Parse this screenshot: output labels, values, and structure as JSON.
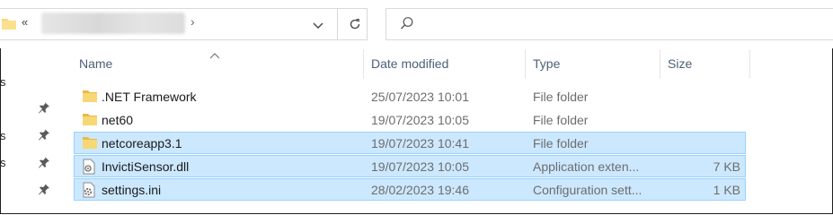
{
  "address": {
    "overflow_chevron": "«",
    "separator": "›",
    "dropdown_icon": "chevron-down-icon",
    "refresh_icon": "refresh-icon"
  },
  "search": {
    "placeholder": "",
    "icon": "search-icon"
  },
  "nav_fragments": [
    "s",
    "s",
    "s"
  ],
  "columns": {
    "name": "Name",
    "date": "Date modified",
    "type": "Type",
    "size": "Size"
  },
  "files": [
    {
      "name": ".NET Framework",
      "date": "25/07/2023 10:01",
      "type": "File folder",
      "size": "",
      "icon": "folder-icon",
      "selected": false
    },
    {
      "name": "net60",
      "date": "19/07/2023 10:05",
      "type": "File folder",
      "size": "",
      "icon": "folder-icon",
      "selected": false
    },
    {
      "name": "netcoreapp3.1",
      "date": "19/07/2023 10:41",
      "type": "File folder",
      "size": "",
      "icon": "folder-icon",
      "selected": true
    },
    {
      "name": "InvictiSensor.dll",
      "date": "19/07/2023 10:05",
      "type": "Application exten...",
      "size": "7 KB",
      "icon": "dll-file-icon",
      "selected": true
    },
    {
      "name": "settings.ini",
      "date": "28/02/2023 19:46",
      "type": "Configuration sett...",
      "size": "1 KB",
      "icon": "settings-file-icon",
      "selected": true
    }
  ],
  "colors": {
    "selection": "#cce8ff",
    "selection_border": "#99d1ff",
    "folder": "#f8d775",
    "header_text": "#4c607a"
  }
}
